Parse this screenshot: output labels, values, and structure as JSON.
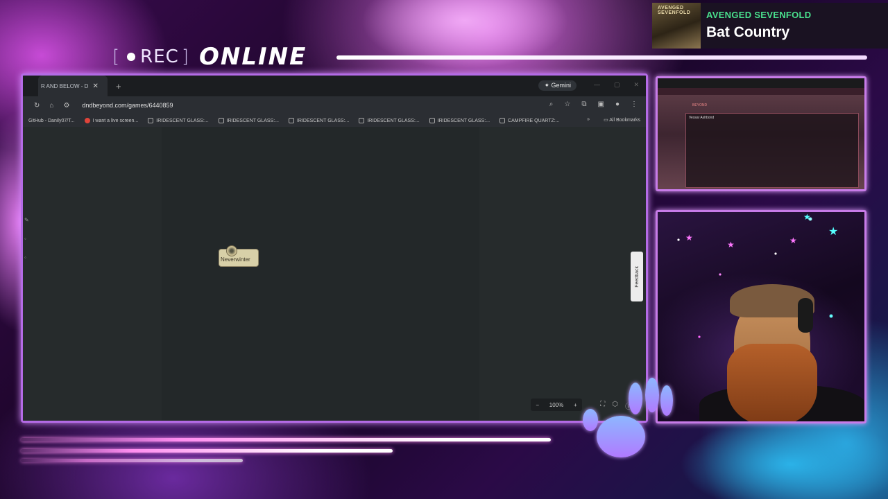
{
  "overlay": {
    "rec_label": "REC",
    "status_label": "ONLINE"
  },
  "now_playing": {
    "album_art_text": "AVENGED SEVENFOLD",
    "artist": "AVENGED SEVENFOLD",
    "song": "Bat Country"
  },
  "browser": {
    "tab_title": "R AND BELOW - D",
    "new_tab_symbol": "+",
    "gemini_label": "✦ Gemini",
    "url": "dndbeyond.com/games/6440859",
    "bookmarks": [
      {
        "label": "GitHub - Danily07/T..."
      },
      {
        "label": "I want a live screen..."
      },
      {
        "label": "IRIDESCENT GLASS:..."
      },
      {
        "label": "IRIDESCENT GLASS:..."
      },
      {
        "label": "IRIDESCENT GLASS:..."
      },
      {
        "label": "IRIDESCENT GLASS:..."
      },
      {
        "label": "IRIDESCENT GLASS:..."
      },
      {
        "label": "CAMPFIRE QUARTZ:..."
      }
    ],
    "bookmarks_overflow": "»",
    "all_bookmarks_label": "All Bookmarks"
  },
  "map": {
    "location_label": "Neverwinter",
    "feedback_label": "Feedback",
    "zoom_level": "100%",
    "zoom_out": "−",
    "zoom_in": "+"
  },
  "preview": {
    "title": "BEYOND",
    "sheet_label": "Vessar Ashbond"
  },
  "colors": {
    "frame_border": "#b46be6",
    "artist_green": "#49e08d",
    "browser_bg": "#212428"
  }
}
